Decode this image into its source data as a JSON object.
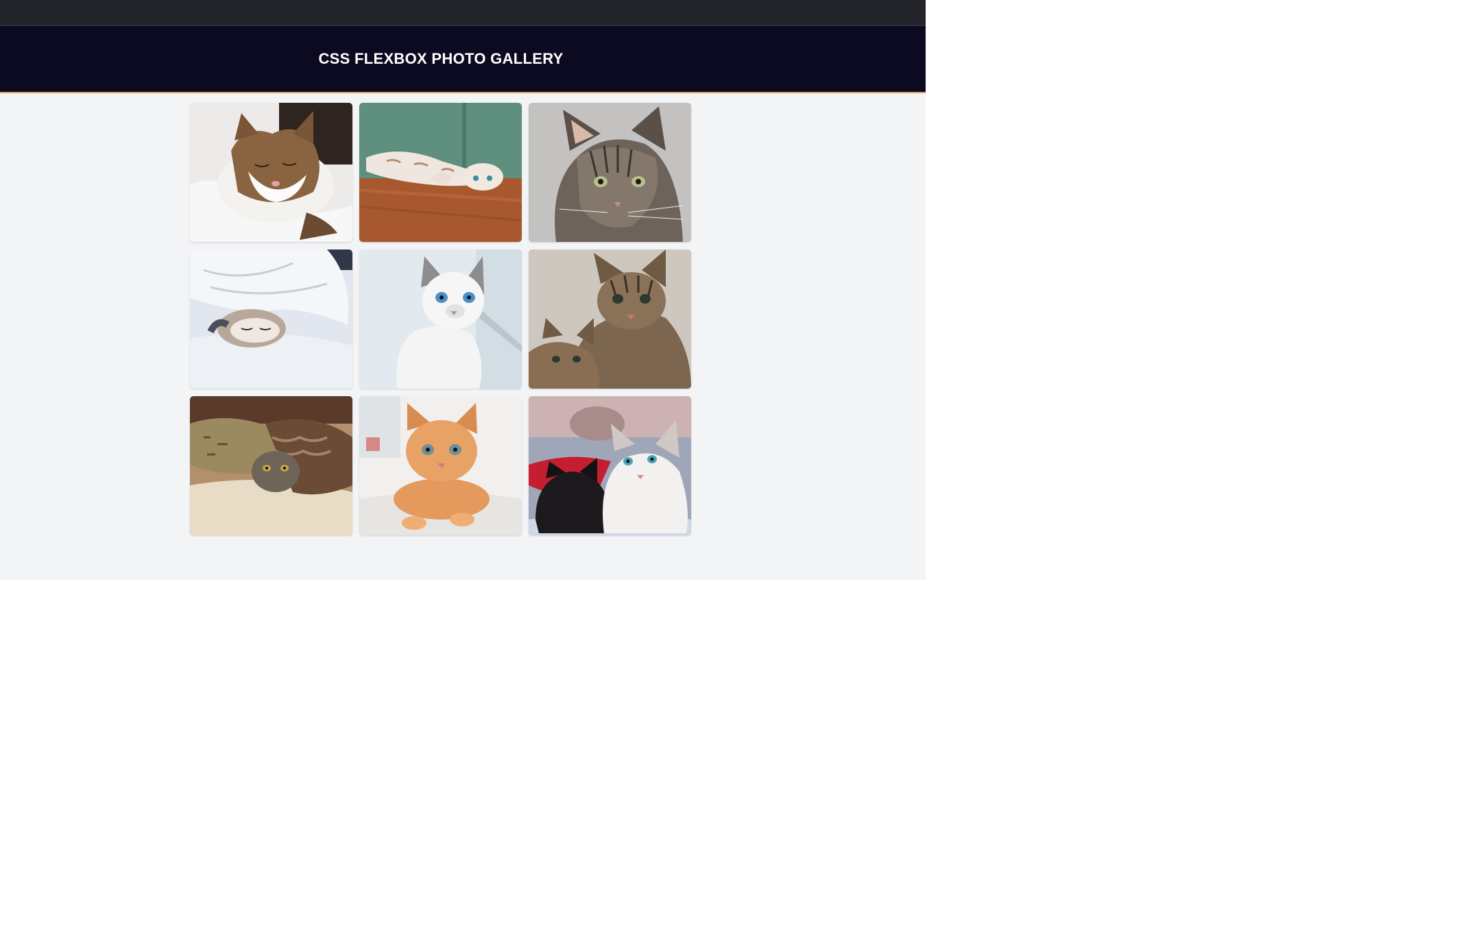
{
  "header": {
    "title": "CSS FLEXBOX PHOTO GALLERY"
  },
  "gallery": {
    "photos": [
      {
        "name": "sleeping-white-tabby-cat-photo",
        "bg": "#e9e6e4",
        "accent": "#8a6a4a"
      },
      {
        "name": "cat-lying-on-wood-floor-photo",
        "bg": "#5a8f7c",
        "accent": "#b06a3c"
      },
      {
        "name": "gray-tabby-cat-portrait-photo",
        "bg": "#b8b6b4",
        "accent": "#5a5048"
      },
      {
        "name": "cat-under-white-blanket-photo",
        "bg": "#dfe3ea",
        "accent": "#8e8a86"
      },
      {
        "name": "white-blue-eyed-kitten-photo",
        "bg": "#dde6ec",
        "accent": "#cfd2d6"
      },
      {
        "name": "two-tabby-kittens-photo",
        "bg": "#c8c2bb",
        "accent": "#6f5a42"
      },
      {
        "name": "cat-under-brown-blanket-photo",
        "bg": "#a88a6e",
        "accent": "#5b4634"
      },
      {
        "name": "orange-kitten-photo",
        "bg": "#efeeec",
        "accent": "#d99a5c"
      },
      {
        "name": "black-and-white-kittens-photo",
        "bg": "#8f98ad",
        "accent": "#c2283a"
      }
    ]
  }
}
